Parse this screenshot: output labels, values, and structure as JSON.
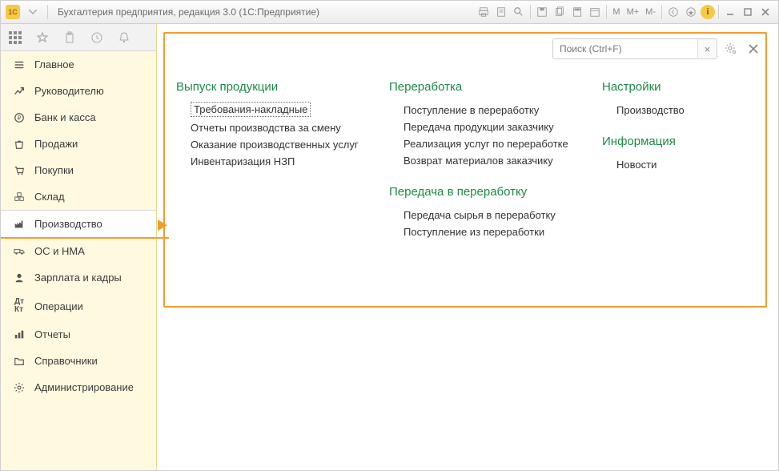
{
  "title": "Бухгалтерия предприятия, редакция 3.0  (1С:Предприятие)",
  "mem": {
    "m": "M",
    "mp": "M+",
    "mm": "M-"
  },
  "sidebar": {
    "items": [
      {
        "label": "Главное"
      },
      {
        "label": "Руководителю"
      },
      {
        "label": "Банк и касса"
      },
      {
        "label": "Продажи"
      },
      {
        "label": "Покупки"
      },
      {
        "label": "Склад"
      },
      {
        "label": "Производство"
      },
      {
        "label": "ОС и НМА"
      },
      {
        "label": "Зарплата и кадры"
      },
      {
        "label": "Операции"
      },
      {
        "label": "Отчеты"
      },
      {
        "label": "Справочники"
      },
      {
        "label": "Администрирование"
      }
    ],
    "active_index": 6
  },
  "search": {
    "placeholder": "Поиск (Ctrl+F)",
    "clear": "×"
  },
  "sections": {
    "col1": [
      {
        "title": "Выпуск продукции",
        "items": [
          "Требования-накладные",
          "Отчеты производства за смену",
          "Оказание производственных услуг",
          "Инвентаризация НЗП"
        ]
      }
    ],
    "col2": [
      {
        "title": "Переработка",
        "items": [
          "Поступление в переработку",
          "Передача продукции заказчику",
          "Реализация услуг по переработке",
          "Возврат материалов заказчику"
        ]
      },
      {
        "title": "Передача в переработку",
        "items": [
          "Передача сырья в переработку",
          "Поступление из переработки"
        ]
      }
    ],
    "col3": [
      {
        "title": "Настройки",
        "items": [
          "Производство"
        ]
      },
      {
        "title": "Информация",
        "items": [
          "Новости"
        ]
      }
    ]
  }
}
